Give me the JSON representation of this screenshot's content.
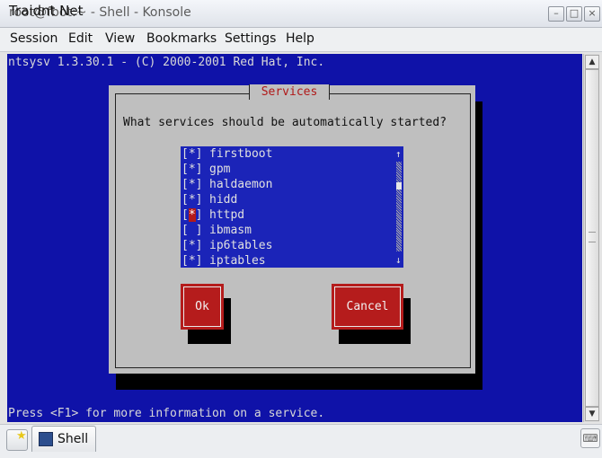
{
  "window": {
    "title": "root@fbot:~ - Shell - Konsole",
    "watermark": "Traidnt Net",
    "minimize_label": "–",
    "maximize_label": "□",
    "close_label": "×"
  },
  "menu": [
    "Session",
    "Edit",
    "View",
    "Bookmarks",
    "Settings",
    "Help"
  ],
  "terminal": {
    "header": "ntsysv 1.3.30.1 - (C) 2000-2001 Red Hat, Inc.",
    "footer": "Press <F1> for more information on a service.",
    "background": "#0f12a8"
  },
  "dialog": {
    "title": "Services",
    "question": "What services should be automatically started?",
    "services": [
      {
        "check": "[*]",
        "name": "firstboot"
      },
      {
        "check": "[*]",
        "name": "gpm"
      },
      {
        "check": "[*]",
        "name": "haldaemon"
      },
      {
        "check": "[*]",
        "name": "hidd"
      },
      {
        "check": "[*]",
        "name": "httpd",
        "focused": true
      },
      {
        "check": "[ ]",
        "name": "ibmasm"
      },
      {
        "check": "[*]",
        "name": "ip6tables"
      },
      {
        "check": "[*]",
        "name": "iptables"
      }
    ],
    "list_scroll_up": "↑",
    "list_scroll_down": "↓",
    "ok_label": "Ok",
    "cancel_label": "Cancel",
    "accent": "#b51c1c"
  },
  "scrollbar": {
    "up": "▲",
    "down": "▼"
  },
  "taskbar": {
    "tab_label": "Shell",
    "left_icon": "konsole-new-session-icon",
    "right_icon": "keyboard-icon",
    "right_glyph": "⌨"
  }
}
